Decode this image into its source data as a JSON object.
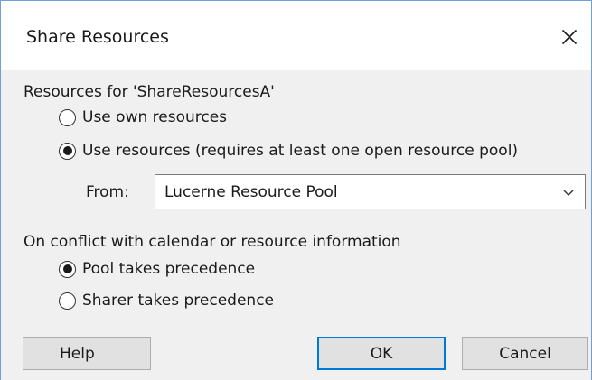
{
  "dialog": {
    "title": "Share Resources",
    "close_icon": "close-icon"
  },
  "resources_group": {
    "label": "Resources for 'ShareResourcesA'",
    "options": [
      {
        "label": "Use own resources",
        "selected": false
      },
      {
        "label": "Use resources (requires at least one open resource pool)",
        "selected": true
      }
    ],
    "from_label": "From:",
    "from_value": "Lucerne Resource Pool"
  },
  "conflict_group": {
    "label": "On conflict with calendar or resource information",
    "options": [
      {
        "label": "Pool takes precedence",
        "selected": true
      },
      {
        "label": "Sharer takes precedence",
        "selected": false
      }
    ]
  },
  "buttons": {
    "help": "Help",
    "ok": "OK",
    "cancel": "Cancel"
  },
  "colors": {
    "window_border": "#6f9fd6",
    "default_button_border": "#0078d7",
    "background": "#f0f0f0"
  }
}
